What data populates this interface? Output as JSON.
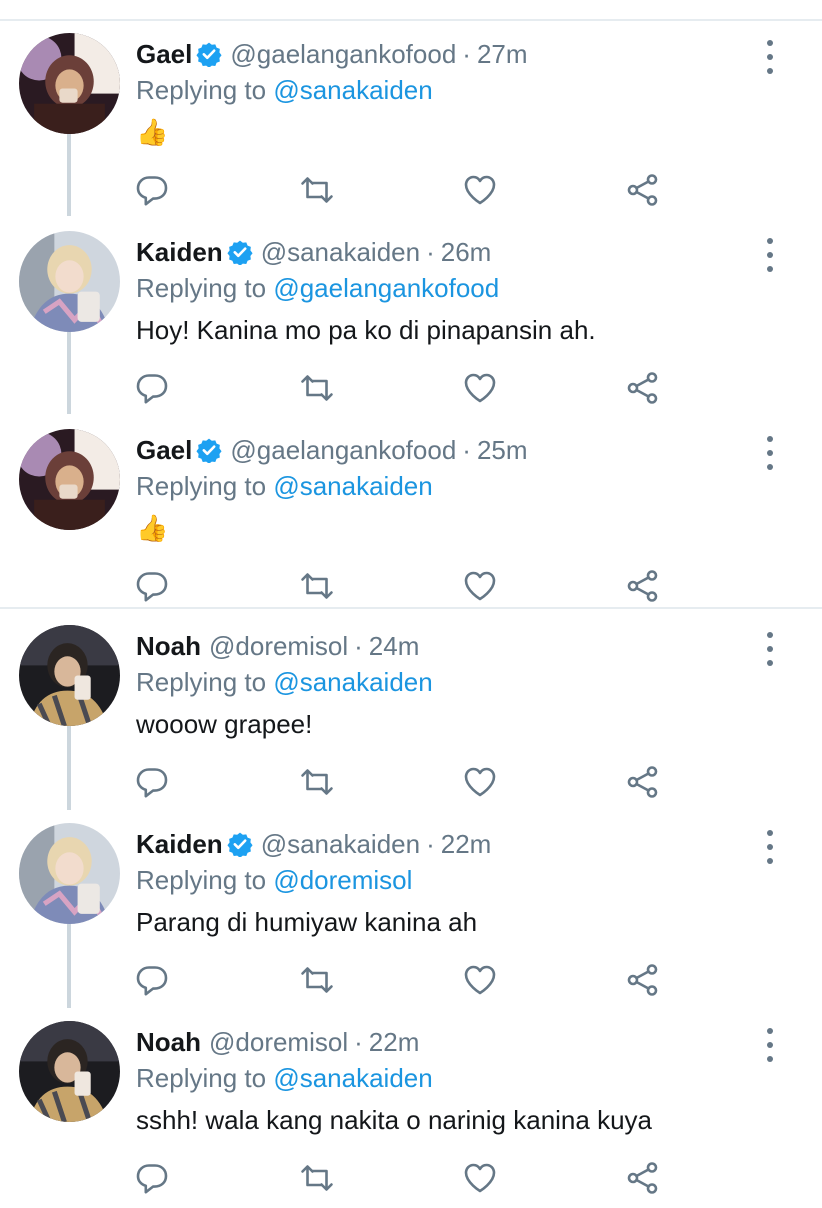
{
  "colors": {
    "link": "#1b95e0",
    "secondary_text": "#657786",
    "primary_text": "#14171a",
    "divider": "#e6ecf0",
    "verified": "#1da1f2"
  },
  "icons": {
    "reply": "reply-icon",
    "retweet": "retweet-icon",
    "like": "heart-icon",
    "share": "share-icon",
    "more": "more-vertical-icon",
    "verified": "verified-badge-icon"
  },
  "tweets": [
    {
      "name": "Gael",
      "verified": true,
      "handle": "@gaelangankofood",
      "separator": "·",
      "time": "27m",
      "replying_prefix": "Replying to",
      "replying_to": "@sanakaiden",
      "text": "👍"
    },
    {
      "name": "Kaiden",
      "verified": true,
      "handle": "@sanakaiden",
      "separator": "·",
      "time": "26m",
      "replying_prefix": "Replying to",
      "replying_to": "@gaelangankofood",
      "text": "Hoy! Kanina mo pa ko di pinapansin ah."
    },
    {
      "name": "Gael",
      "verified": true,
      "handle": "@gaelangankofood",
      "separator": "·",
      "time": "25m",
      "replying_prefix": "Replying to",
      "replying_to": "@sanakaiden",
      "text": "👍"
    },
    {
      "name": "Noah",
      "verified": false,
      "handle": "@doremisol",
      "separator": "·",
      "time": "24m",
      "replying_prefix": "Replying to",
      "replying_to": "@sanakaiden",
      "text": "wooow grapee!"
    },
    {
      "name": "Kaiden",
      "verified": true,
      "handle": "@sanakaiden",
      "separator": "·",
      "time": "22m",
      "replying_prefix": "Replying to",
      "replying_to": "@doremisol",
      "text": "Parang di humiyaw kanina ah"
    },
    {
      "name": "Noah",
      "verified": false,
      "handle": "@doremisol",
      "separator": "·",
      "time": "22m",
      "replying_prefix": "Replying to",
      "replying_to": "@sanakaiden",
      "text": "sshh! wala kang nakita o narinig kanina kuya"
    }
  ]
}
